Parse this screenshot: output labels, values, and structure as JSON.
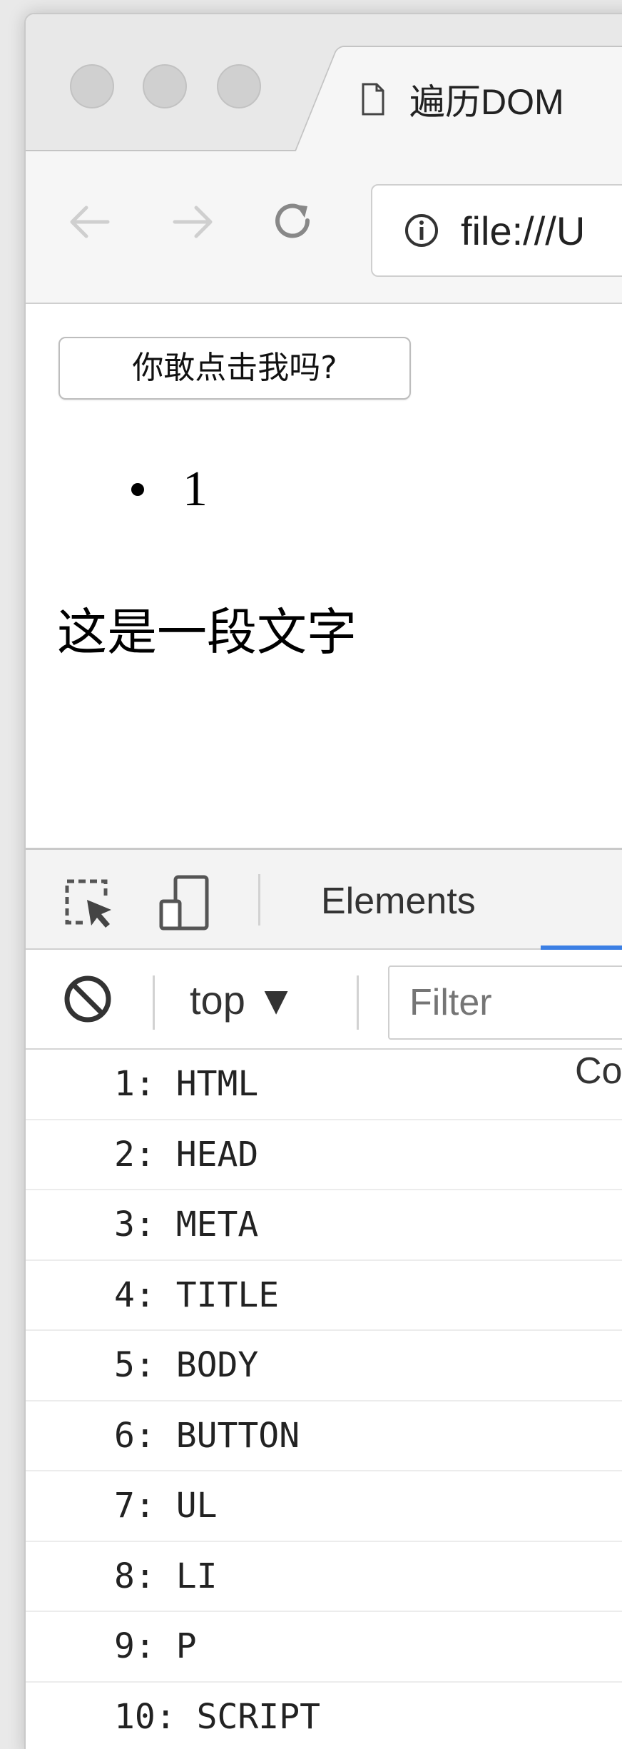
{
  "browser": {
    "tab_title": "遍历DOM",
    "url": "file:///U",
    "icons": {
      "back": "arrow-left-icon",
      "forward": "arrow-right-icon",
      "reload": "reload-icon",
      "info": "info-icon",
      "page": "document-icon"
    }
  },
  "page": {
    "button_label": "你敢点击我吗?",
    "list_items": [
      "1"
    ],
    "paragraph": "这是一段文字"
  },
  "devtools": {
    "tabs": [
      "Elements",
      "Co"
    ],
    "context": "top ▼",
    "filter_placeholder": "Filter",
    "accent": "#3b7fe4",
    "logs": [
      "1: HTML",
      "2: HEAD",
      "3: META",
      "4: TITLE",
      "5: BODY",
      "6: BUTTON",
      "7: UL",
      "8: LI",
      "9: P",
      "10: SCRIPT"
    ]
  }
}
